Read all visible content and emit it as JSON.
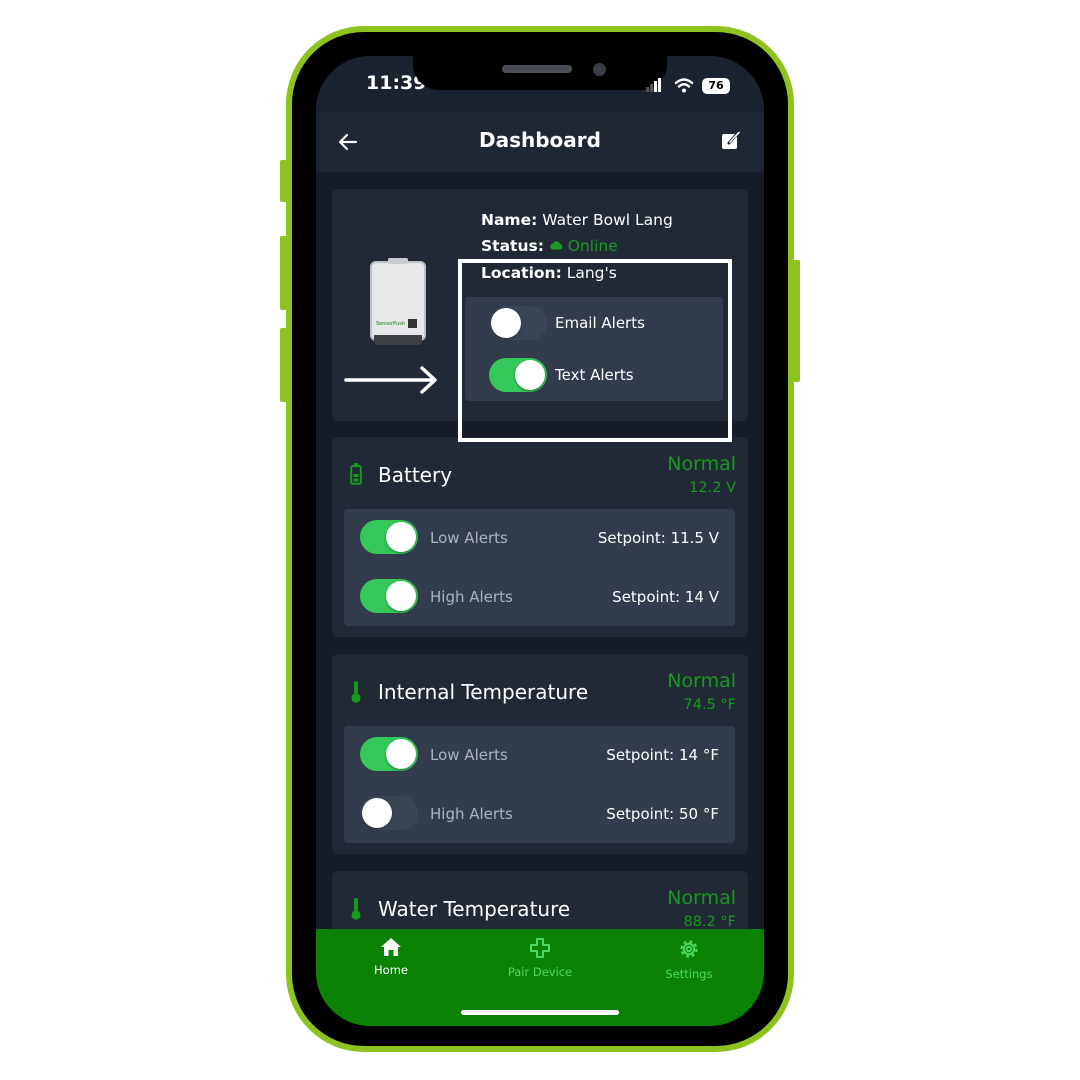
{
  "status_bar": {
    "time": "11:39",
    "battery": "76"
  },
  "header": {
    "title": "Dashboard",
    "back_icon": "arrow-left-icon",
    "edit_icon": "edit-square-icon"
  },
  "device": {
    "name_label": "Name:",
    "name": "Water Bowl Lang",
    "status_label": "Status:",
    "status": "Online",
    "location_label": "Location:",
    "location": "Lang's",
    "device_logo_text": "SensorPush",
    "notifications": [
      {
        "label": "Email Alerts",
        "on": false
      },
      {
        "label": "Text Alerts",
        "on": true
      }
    ]
  },
  "sensors": [
    {
      "title": "Battery",
      "icon": "battery-icon",
      "status": "Normal",
      "value": "12.2  V",
      "alerts": [
        {
          "label": "Low Alerts",
          "on": true,
          "setpoint": "Setpoint: 11.5 V"
        },
        {
          "label": "High Alerts",
          "on": true,
          "setpoint": "Setpoint: 14 V"
        }
      ]
    },
    {
      "title": "Internal Temperature",
      "icon": "thermometer-icon",
      "status": "Normal",
      "value": "74.5  °F",
      "alerts": [
        {
          "label": "Low Alerts",
          "on": true,
          "setpoint": "Setpoint: 14 °F"
        },
        {
          "label": "High Alerts",
          "on": false,
          "setpoint": "Setpoint: 50 °F"
        }
      ]
    },
    {
      "title": "Water Temperature",
      "icon": "thermometer-icon",
      "status": "Normal",
      "value": "88.2  °F"
    }
  ],
  "nav": [
    {
      "label": "Home",
      "icon": "home-icon",
      "active": true
    },
    {
      "label": "Pair Device",
      "icon": "plus-icon",
      "active": false
    },
    {
      "label": "Settings",
      "icon": "gear-icon",
      "active": false
    }
  ],
  "colors": {
    "frame": "#8dc21f",
    "accent_green": "#169a1b",
    "toggle_on": "#34c759",
    "nav_bg": "#0b8203",
    "nav_inactive": "#4cd964"
  }
}
